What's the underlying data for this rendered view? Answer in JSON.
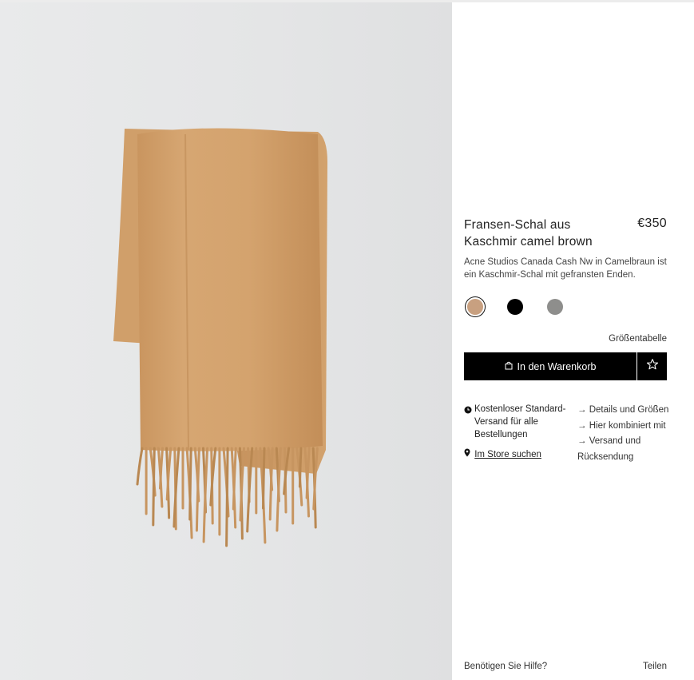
{
  "product": {
    "title": "Fransen-Schal aus Kaschmir camel brown",
    "price": "€350",
    "description": "Acne Studios Canada Cash Nw in Camelbraun ist ein Kaschmir-Schal mit gefransten Enden.",
    "image_icon": "camel-scarf-photo"
  },
  "swatches": [
    {
      "name": "camel",
      "color": "#c8a080",
      "selected": true
    },
    {
      "name": "black",
      "color": "#000000",
      "selected": false
    },
    {
      "name": "grey",
      "color": "#8e8e8c",
      "selected": false
    }
  ],
  "size_chart_label": "Größentabelle",
  "cart": {
    "label": "In den Warenkorb",
    "icon": "shopping-bag-icon"
  },
  "wishlist": {
    "icon": "star-icon"
  },
  "shipping": {
    "text": "Kostenloser Standard-Versand für alle Bestellungen",
    "icon": "clock-icon"
  },
  "store": {
    "label": "Im Store suchen",
    "icon": "map-pin-icon"
  },
  "links": [
    {
      "label": "Details und Größen"
    },
    {
      "label": "Hier kombiniert mit"
    },
    {
      "label": "Versand und Rücksendung"
    }
  ],
  "footer": {
    "help": "Benötigen Sie Hilfe?",
    "share": "Teilen"
  },
  "colors": {
    "button_bg": "#000000",
    "scarf": "#d1a06c",
    "background": "#e6e7e8"
  }
}
